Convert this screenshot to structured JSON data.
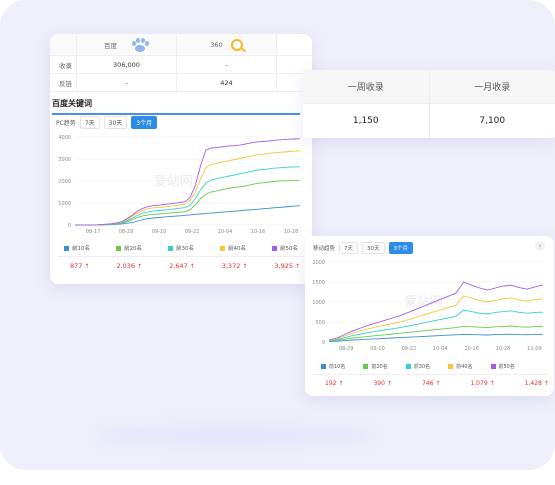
{
  "top_table": {
    "headers": [
      "百度",
      "360"
    ],
    "rows": [
      {
        "label": "收录",
        "baidu": "306,000",
        "s360": "-"
      },
      {
        "label": "反链",
        "baidu": "-",
        "s360": "424"
      }
    ]
  },
  "week_month_table": {
    "headers": [
      "一周收录",
      "一月收录"
    ],
    "values": [
      "1,150",
      "7,100"
    ]
  },
  "keywords_section": {
    "title": "百度关键词"
  },
  "pc_panel": {
    "trend_label": "PC趋势",
    "tabs": [
      "7天",
      "30天",
      "3个月"
    ],
    "active_tab": "3个月",
    "watermark": "爱站网",
    "legend": [
      "前10名",
      "前20名",
      "前30名",
      "前40名",
      "前50名"
    ],
    "final_values": [
      "877",
      "2,036",
      "2,647",
      "3,372",
      "3,925"
    ]
  },
  "mobile_panel": {
    "trend_label": "移动趋势",
    "tabs": [
      "7天",
      "30天",
      "3个月"
    ],
    "active_tab": "3个月",
    "watermark": "爱站网",
    "legend": [
      "前10名",
      "前20名",
      "前30名",
      "前40名",
      "前50名"
    ],
    "final_values": [
      "192",
      "390",
      "746",
      "1,079",
      "1,428"
    ]
  },
  "colors": {
    "top10": "#3a8fd9",
    "top20": "#6bc84a",
    "top30": "#38cfd2",
    "top40": "#f7c43a",
    "top50": "#a25ce6",
    "accent": "#2d8ce6",
    "up": "#e52e2e"
  },
  "chart_data": [
    {
      "type": "line",
      "title": "PC趋势",
      "x_ticks": [
        "08-17",
        "08-29",
        "09-10",
        "09-22",
        "10-04",
        "10-16",
        "10-28"
      ],
      "ylim": [
        0,
        4000
      ],
      "y_ticks": [
        0,
        1000,
        2000,
        3000,
        4000
      ],
      "series": [
        {
          "name": "前10名",
          "values": [
            0,
            0,
            0,
            0,
            0,
            5,
            10,
            15,
            30,
            50,
            80,
            120,
            180,
            250,
            300,
            320,
            340,
            360,
            380,
            400,
            420,
            440,
            460,
            480,
            500,
            520,
            540,
            560,
            580,
            600,
            620,
            640,
            660,
            680,
            700,
            720,
            740,
            760,
            780,
            800,
            820,
            840,
            860,
            877
          ]
        },
        {
          "name": "前20名",
          "values": [
            0,
            0,
            0,
            0,
            5,
            10,
            20,
            30,
            50,
            80,
            150,
            250,
            350,
            420,
            460,
            480,
            500,
            520,
            540,
            560,
            580,
            600,
            700,
            900,
            1200,
            1400,
            1500,
            1550,
            1600,
            1650,
            1700,
            1720,
            1750,
            1800,
            1850,
            1900,
            1920,
            1950,
            1980,
            2000,
            2010,
            2020,
            2030,
            2036
          ]
        },
        {
          "name": "前30名",
          "values": [
            0,
            0,
            0,
            0,
            5,
            12,
            25,
            40,
            70,
            110,
            200,
            320,
            450,
            540,
            600,
            640,
            660,
            680,
            700,
            730,
            760,
            790,
            900,
            1200,
            1600,
            1900,
            2050,
            2100,
            2150,
            2200,
            2250,
            2300,
            2350,
            2400,
            2450,
            2500,
            2520,
            2550,
            2580,
            2600,
            2620,
            2630,
            2640,
            2647
          ]
        },
        {
          "name": "前40名",
          "values": [
            0,
            0,
            0,
            0,
            5,
            15,
            30,
            50,
            90,
            140,
            260,
            400,
            560,
            670,
            740,
            780,
            800,
            820,
            850,
            880,
            910,
            950,
            1100,
            1500,
            2100,
            2600,
            2750,
            2800,
            2850,
            2900,
            2950,
            3000,
            3050,
            3100,
            3150,
            3200,
            3220,
            3250,
            3280,
            3300,
            3320,
            3340,
            3360,
            3372
          ]
        },
        {
          "name": "前50名",
          "values": [
            0,
            0,
            0,
            0,
            6,
            18,
            35,
            60,
            100,
            160,
            300,
            460,
            640,
            760,
            840,
            880,
            900,
            930,
            960,
            990,
            1020,
            1060,
            1250,
            1800,
            2700,
            3400,
            3500,
            3520,
            3550,
            3580,
            3600,
            3620,
            3650,
            3700,
            3750,
            3780,
            3800,
            3820,
            3850,
            3870,
            3890,
            3900,
            3910,
            3925
          ]
        }
      ]
    },
    {
      "type": "line",
      "title": "移动趋势",
      "x_ticks": [
        "08-29",
        "09-10",
        "09-22",
        "10-04",
        "10-16",
        "10-28",
        "11-09"
      ],
      "ylim": [
        0,
        2000
      ],
      "y_ticks": [
        0,
        500,
        1000,
        1500,
        2000
      ],
      "series": [
        {
          "name": "前10名",
          "values": [
            10,
            20,
            35,
            50,
            60,
            70,
            80,
            90,
            100,
            110,
            120,
            130,
            140,
            150,
            160,
            170,
            180,
            190,
            185,
            180,
            175,
            185,
            190,
            195,
            185,
            180,
            190,
            192
          ]
        },
        {
          "name": "前20名",
          "values": [
            20,
            40,
            70,
            100,
            120,
            140,
            160,
            180,
            200,
            220,
            240,
            260,
            280,
            300,
            320,
            340,
            360,
            390,
            380,
            370,
            360,
            380,
            390,
            400,
            380,
            370,
            385,
            390
          ]
        },
        {
          "name": "前30名",
          "values": [
            30,
            60,
            110,
            160,
            200,
            240,
            270,
            300,
            330,
            360,
            400,
            440,
            480,
            520,
            560,
            600,
            640,
            800,
            760,
            720,
            700,
            740,
            760,
            780,
            740,
            720,
            740,
            746
          ]
        },
        {
          "name": "前40名",
          "values": [
            40,
            80,
            150,
            220,
            280,
            330,
            380,
            420,
            460,
            500,
            560,
            620,
            680,
            740,
            800,
            860,
            920,
            1150,
            1100,
            1040,
            1000,
            1040,
            1080,
            1100,
            1050,
            1020,
            1060,
            1079
          ]
        },
        {
          "name": "前50名",
          "values": [
            50,
            100,
            190,
            280,
            350,
            420,
            480,
            540,
            600,
            660,
            740,
            820,
            900,
            980,
            1060,
            1140,
            1220,
            1500,
            1420,
            1350,
            1300,
            1350,
            1400,
            1420,
            1360,
            1320,
            1380,
            1428
          ]
        }
      ]
    }
  ]
}
